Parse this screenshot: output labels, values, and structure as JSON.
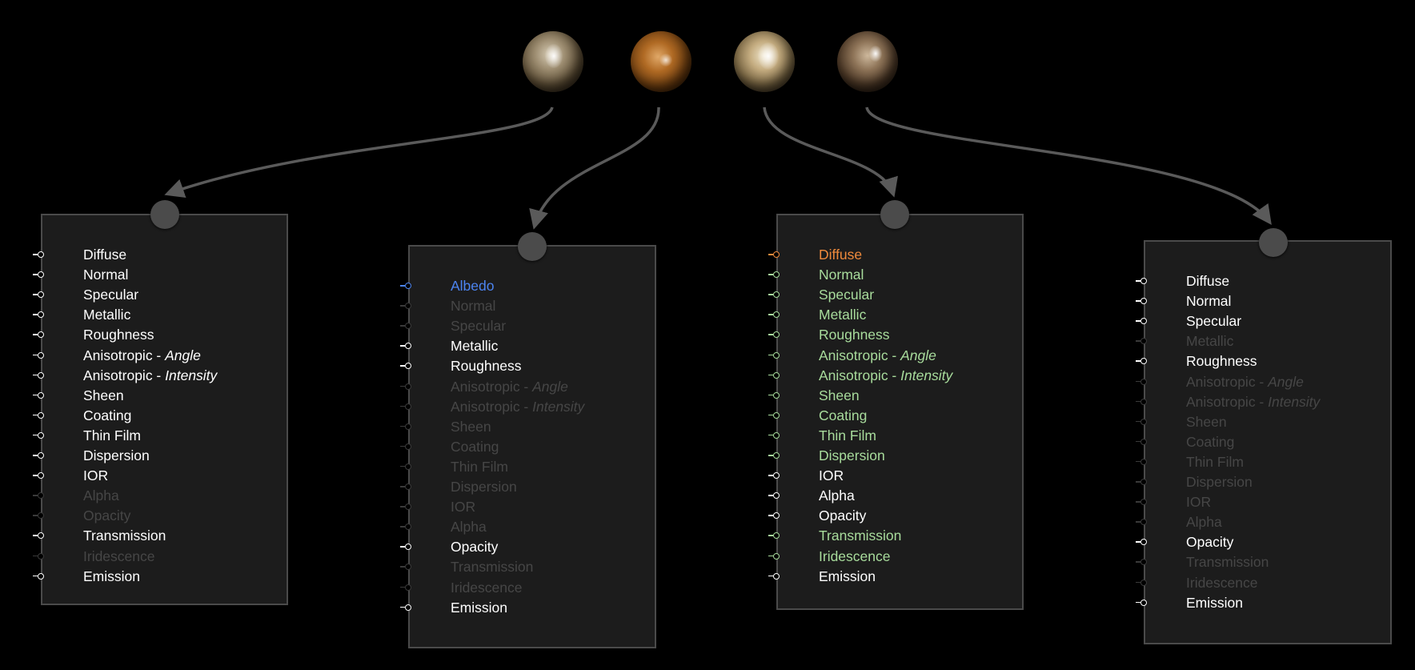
{
  "spheres": [
    {
      "name": "brushed-metal-sphere-1"
    },
    {
      "name": "copper-sphere-2"
    },
    {
      "name": "gold-sphere-3"
    },
    {
      "name": "bronze-sphere-4"
    }
  ],
  "colors": {
    "background": "#000000",
    "panel": "#1c1c1c",
    "panel_border": "#4a4a4a",
    "connector": "#5a5a5a",
    "active": "#ffffff",
    "inactive": "#464646",
    "green": "#a8dc9c",
    "orange": "#ef8a3c",
    "blue": "#4c84f0"
  },
  "panels": [
    {
      "items": [
        {
          "label": "Diffuse",
          "state": "white"
        },
        {
          "label": "Normal",
          "state": "white"
        },
        {
          "label": "Specular",
          "state": "white"
        },
        {
          "label": "Metallic",
          "state": "white"
        },
        {
          "label": "Roughness",
          "state": "white"
        },
        {
          "label": "Anisotropic - ",
          "suffix": "Angle",
          "state": "white"
        },
        {
          "label": "Anisotropic - ",
          "suffix": "Intensity",
          "state": "white"
        },
        {
          "label": "Sheen",
          "state": "white"
        },
        {
          "label": "Coating",
          "state": "white"
        },
        {
          "label": "Thin Film",
          "state": "white"
        },
        {
          "label": "Dispersion",
          "state": "white"
        },
        {
          "label": "IOR",
          "state": "white"
        },
        {
          "label": "Alpha",
          "state": "dim"
        },
        {
          "label": "Opacity",
          "state": "dim"
        },
        {
          "label": "Transmission",
          "state": "white"
        },
        {
          "label": "Iridescence",
          "state": "dim"
        },
        {
          "label": "Emission",
          "state": "white"
        }
      ]
    },
    {
      "items": [
        {
          "label": "Albedo",
          "state": "blue"
        },
        {
          "label": "Normal",
          "state": "dim"
        },
        {
          "label": "Specular",
          "state": "dim"
        },
        {
          "label": "Metallic",
          "state": "white"
        },
        {
          "label": "Roughness",
          "state": "white"
        },
        {
          "label": "Anisotropic - ",
          "suffix": "Angle",
          "state": "dim"
        },
        {
          "label": "Anisotropic - ",
          "suffix": "Intensity",
          "state": "dim"
        },
        {
          "label": "Sheen",
          "state": "dim"
        },
        {
          "label": "Coating",
          "state": "dim"
        },
        {
          "label": "Thin Film",
          "state": "dim"
        },
        {
          "label": "Dispersion",
          "state": "dim"
        },
        {
          "label": "IOR",
          "state": "dim"
        },
        {
          "label": "Alpha",
          "state": "dim"
        },
        {
          "label": "Opacity",
          "state": "white"
        },
        {
          "label": "Transmission",
          "state": "dim"
        },
        {
          "label": "Iridescence",
          "state": "dim"
        },
        {
          "label": "Emission",
          "state": "white"
        }
      ]
    },
    {
      "items": [
        {
          "label": "Diffuse",
          "state": "orange"
        },
        {
          "label": "Normal",
          "state": "green"
        },
        {
          "label": "Specular",
          "state": "green"
        },
        {
          "label": "Metallic",
          "state": "green"
        },
        {
          "label": "Roughness",
          "state": "green"
        },
        {
          "label": "Anisotropic - ",
          "suffix": "Angle",
          "state": "green"
        },
        {
          "label": "Anisotropic - ",
          "suffix": "Intensity",
          "state": "green"
        },
        {
          "label": "Sheen",
          "state": "green"
        },
        {
          "label": "Coating",
          "state": "green"
        },
        {
          "label": "Thin Film",
          "state": "green"
        },
        {
          "label": "Dispersion",
          "state": "green"
        },
        {
          "label": "IOR",
          "state": "white"
        },
        {
          "label": "Alpha",
          "state": "white"
        },
        {
          "label": "Opacity",
          "state": "white"
        },
        {
          "label": "Transmission",
          "state": "green"
        },
        {
          "label": "Iridescence",
          "state": "green"
        },
        {
          "label": "Emission",
          "state": "white"
        }
      ]
    },
    {
      "items": [
        {
          "label": "Diffuse",
          "state": "white"
        },
        {
          "label": "Normal",
          "state": "white"
        },
        {
          "label": "Specular",
          "state": "white"
        },
        {
          "label": "Metallic",
          "state": "dim"
        },
        {
          "label": "Roughness",
          "state": "white"
        },
        {
          "label": "Anisotropic - ",
          "suffix": "Angle",
          "state": "dim"
        },
        {
          "label": "Anisotropic - ",
          "suffix": "Intensity",
          "state": "dim"
        },
        {
          "label": "Sheen",
          "state": "dim"
        },
        {
          "label": "Coating",
          "state": "dim"
        },
        {
          "label": "Thin Film",
          "state": "dim"
        },
        {
          "label": "Dispersion",
          "state": "dim"
        },
        {
          "label": "IOR",
          "state": "dim"
        },
        {
          "label": "Alpha",
          "state": "dim"
        },
        {
          "label": "Opacity",
          "state": "white"
        },
        {
          "label": "Transmission",
          "state": "dim"
        },
        {
          "label": "Iridescence",
          "state": "dim"
        },
        {
          "label": "Emission",
          "state": "white"
        }
      ]
    }
  ]
}
